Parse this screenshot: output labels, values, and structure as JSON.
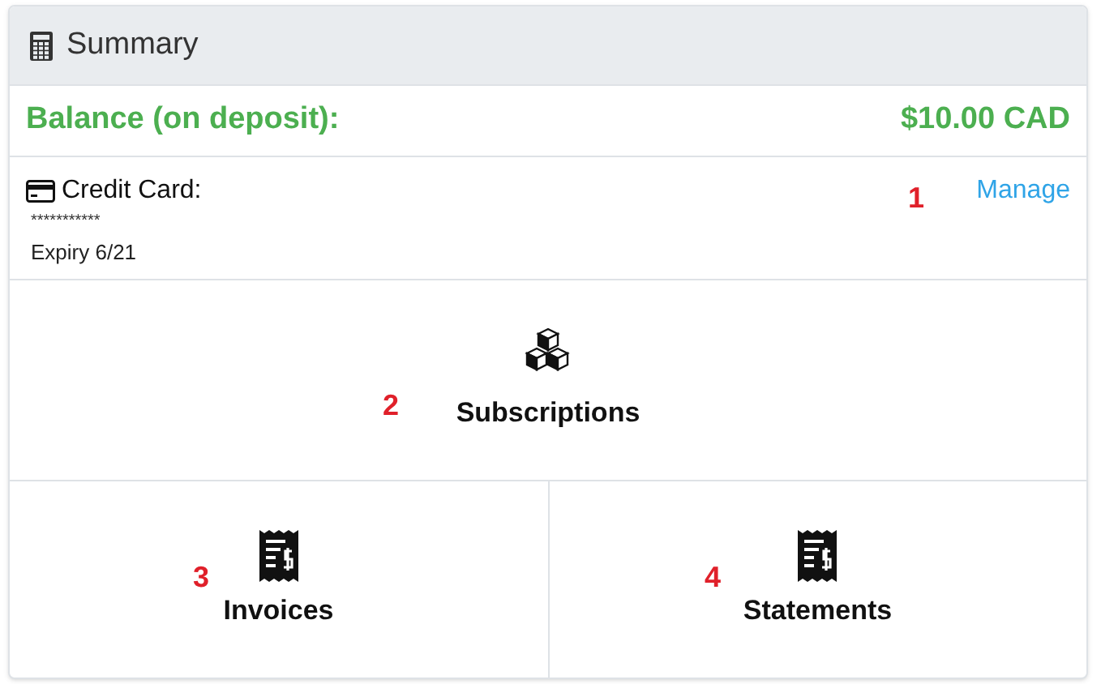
{
  "header": {
    "title": "Summary"
  },
  "balance": {
    "label": "Balance (on deposit):",
    "amount": "$10.00 CAD"
  },
  "card": {
    "label": "Credit Card:",
    "number": "***********",
    "expiry": "Expiry 6/21",
    "marker": "1",
    "link": "Manage"
  },
  "tiles": [
    {
      "label": "Subscriptions",
      "kind": "cubes",
      "marker": "2"
    },
    {
      "label": "Invoices",
      "kind": "receipt",
      "marker": "3"
    },
    {
      "label": "Statements",
      "kind": "receipt",
      "marker": "4"
    }
  ]
}
